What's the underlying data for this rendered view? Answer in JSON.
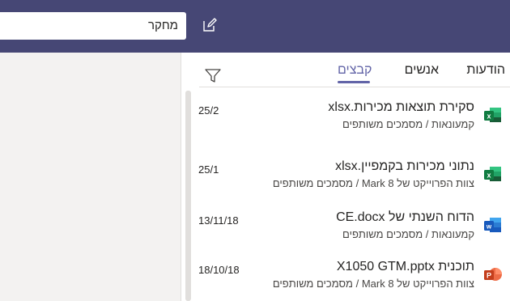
{
  "header": {
    "search_value": "מחקר",
    "compose_icon": "compose-icon"
  },
  "tabs": [
    {
      "label": "הודעות",
      "active": false
    },
    {
      "label": "אנשים",
      "active": false
    },
    {
      "label": "קבצים",
      "active": true
    }
  ],
  "filter_icon": "filter-icon",
  "files": [
    {
      "name": "סקירת תוצאות מכירות.xlsx",
      "path": "קמעונאות / מסמכים משותפים",
      "date": "25/2",
      "type": "excel"
    },
    {
      "name": "נתוני מכירות בקמפיין.xlsx",
      "path": "צוות הפרוייקט של Mark 8 / מסמכים משותפים",
      "date": "25/1",
      "type": "excel"
    },
    {
      "name": "הדוח השנתי של CE.docx",
      "path": "קמעונאות / מסמכים משותפים",
      "date": "13/11/18",
      "type": "word"
    },
    {
      "name": "תוכנית X1050 GTM.pptx",
      "path": "צוות הפרוייקט של Mark 8 / מסמכים משותפים",
      "date": "18/10/18",
      "type": "powerpoint"
    }
  ],
  "colors": {
    "header_bg": "#464775",
    "accent": "#6264a7",
    "excel": "#1e7145",
    "word": "#2b579a",
    "powerpoint": "#d24726"
  }
}
